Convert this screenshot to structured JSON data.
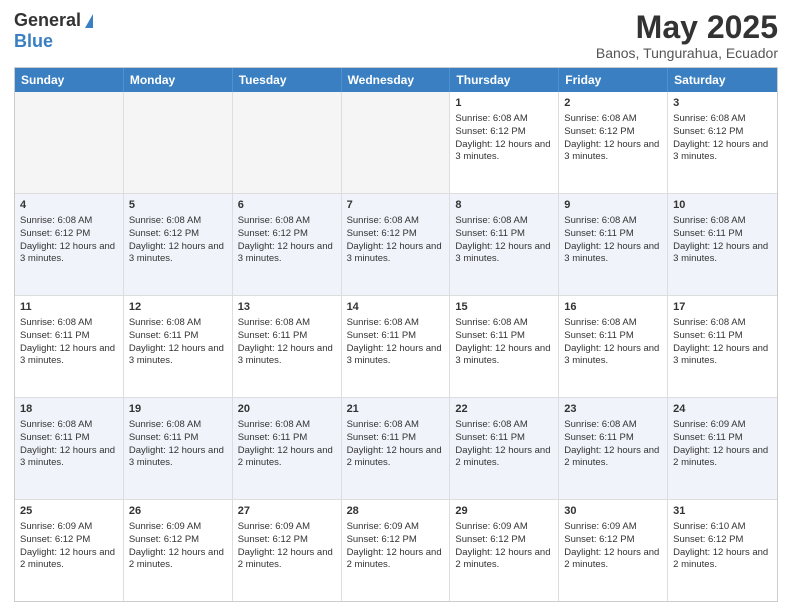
{
  "header": {
    "logo_general": "General",
    "logo_blue": "Blue",
    "main_title": "May 2025",
    "subtitle": "Banos, Tungurahua, Ecuador"
  },
  "calendar": {
    "days": [
      "Sunday",
      "Monday",
      "Tuesday",
      "Wednesday",
      "Thursday",
      "Friday",
      "Saturday"
    ],
    "weeks": [
      [
        {
          "day": "",
          "empty": true
        },
        {
          "day": "",
          "empty": true
        },
        {
          "day": "",
          "empty": true
        },
        {
          "day": "",
          "empty": true
        },
        {
          "day": "1",
          "sunrise": "6:08 AM",
          "sunset": "6:12 PM",
          "daylight": "12 hours and 3 minutes."
        },
        {
          "day": "2",
          "sunrise": "6:08 AM",
          "sunset": "6:12 PM",
          "daylight": "12 hours and 3 minutes."
        },
        {
          "day": "3",
          "sunrise": "6:08 AM",
          "sunset": "6:12 PM",
          "daylight": "12 hours and 3 minutes."
        }
      ],
      [
        {
          "day": "4",
          "sunrise": "6:08 AM",
          "sunset": "6:12 PM",
          "daylight": "12 hours and 3 minutes."
        },
        {
          "day": "5",
          "sunrise": "6:08 AM",
          "sunset": "6:12 PM",
          "daylight": "12 hours and 3 minutes."
        },
        {
          "day": "6",
          "sunrise": "6:08 AM",
          "sunset": "6:12 PM",
          "daylight": "12 hours and 3 minutes."
        },
        {
          "day": "7",
          "sunrise": "6:08 AM",
          "sunset": "6:12 PM",
          "daylight": "12 hours and 3 minutes."
        },
        {
          "day": "8",
          "sunrise": "6:08 AM",
          "sunset": "6:11 PM",
          "daylight": "12 hours and 3 minutes."
        },
        {
          "day": "9",
          "sunrise": "6:08 AM",
          "sunset": "6:11 PM",
          "daylight": "12 hours and 3 minutes."
        },
        {
          "day": "10",
          "sunrise": "6:08 AM",
          "sunset": "6:11 PM",
          "daylight": "12 hours and 3 minutes."
        }
      ],
      [
        {
          "day": "11",
          "sunrise": "6:08 AM",
          "sunset": "6:11 PM",
          "daylight": "12 hours and 3 minutes."
        },
        {
          "day": "12",
          "sunrise": "6:08 AM",
          "sunset": "6:11 PM",
          "daylight": "12 hours and 3 minutes."
        },
        {
          "day": "13",
          "sunrise": "6:08 AM",
          "sunset": "6:11 PM",
          "daylight": "12 hours and 3 minutes."
        },
        {
          "day": "14",
          "sunrise": "6:08 AM",
          "sunset": "6:11 PM",
          "daylight": "12 hours and 3 minutes."
        },
        {
          "day": "15",
          "sunrise": "6:08 AM",
          "sunset": "6:11 PM",
          "daylight": "12 hours and 3 minutes."
        },
        {
          "day": "16",
          "sunrise": "6:08 AM",
          "sunset": "6:11 PM",
          "daylight": "12 hours and 3 minutes."
        },
        {
          "day": "17",
          "sunrise": "6:08 AM",
          "sunset": "6:11 PM",
          "daylight": "12 hours and 3 minutes."
        }
      ],
      [
        {
          "day": "18",
          "sunrise": "6:08 AM",
          "sunset": "6:11 PM",
          "daylight": "12 hours and 3 minutes."
        },
        {
          "day": "19",
          "sunrise": "6:08 AM",
          "sunset": "6:11 PM",
          "daylight": "12 hours and 3 minutes."
        },
        {
          "day": "20",
          "sunrise": "6:08 AM",
          "sunset": "6:11 PM",
          "daylight": "12 hours and 2 minutes."
        },
        {
          "day": "21",
          "sunrise": "6:08 AM",
          "sunset": "6:11 PM",
          "daylight": "12 hours and 2 minutes."
        },
        {
          "day": "22",
          "sunrise": "6:08 AM",
          "sunset": "6:11 PM",
          "daylight": "12 hours and 2 minutes."
        },
        {
          "day": "23",
          "sunrise": "6:08 AM",
          "sunset": "6:11 PM",
          "daylight": "12 hours and 2 minutes."
        },
        {
          "day": "24",
          "sunrise": "6:09 AM",
          "sunset": "6:11 PM",
          "daylight": "12 hours and 2 minutes."
        }
      ],
      [
        {
          "day": "25",
          "sunrise": "6:09 AM",
          "sunset": "6:12 PM",
          "daylight": "12 hours and 2 minutes."
        },
        {
          "day": "26",
          "sunrise": "6:09 AM",
          "sunset": "6:12 PM",
          "daylight": "12 hours and 2 minutes."
        },
        {
          "day": "27",
          "sunrise": "6:09 AM",
          "sunset": "6:12 PM",
          "daylight": "12 hours and 2 minutes."
        },
        {
          "day": "28",
          "sunrise": "6:09 AM",
          "sunset": "6:12 PM",
          "daylight": "12 hours and 2 minutes."
        },
        {
          "day": "29",
          "sunrise": "6:09 AM",
          "sunset": "6:12 PM",
          "daylight": "12 hours and 2 minutes."
        },
        {
          "day": "30",
          "sunrise": "6:09 AM",
          "sunset": "6:12 PM",
          "daylight": "12 hours and 2 minutes."
        },
        {
          "day": "31",
          "sunrise": "6:10 AM",
          "sunset": "6:12 PM",
          "daylight": "12 hours and 2 minutes."
        }
      ]
    ],
    "labels": {
      "sunrise": "Sunrise:",
      "sunset": "Sunset:",
      "daylight": "Daylight:"
    }
  }
}
